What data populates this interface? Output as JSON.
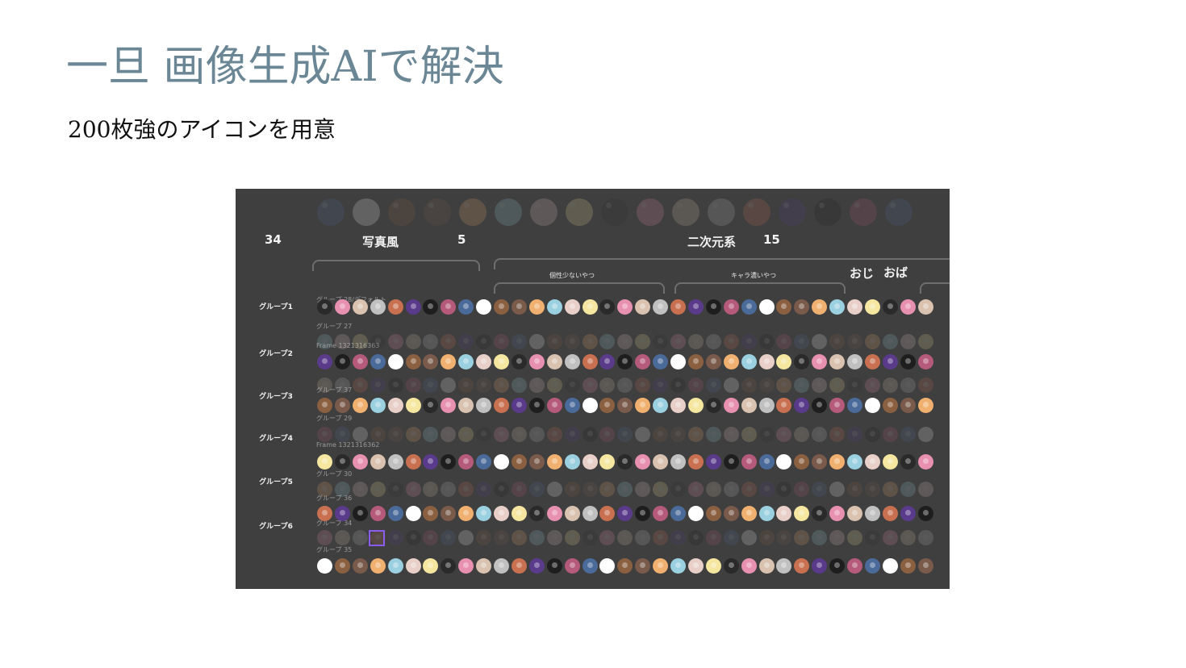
{
  "slide": {
    "title": "一旦 画像生成AIで解決",
    "subtitle": "200枚強のアイコンを用意"
  },
  "figma": {
    "counts": {
      "left": "34",
      "photo": "5",
      "anime": "15"
    },
    "headers": {
      "photo": "写真風",
      "anime": "二次元系",
      "oji": "おじ",
      "oba": "おば"
    },
    "sub_headers": {
      "first": "個性少ないやつ",
      "second": "キャラ濃いやつ"
    },
    "groups": [
      "グループ1",
      "グループ2",
      "グループ3",
      "グループ4",
      "グループ5",
      "グループ6"
    ],
    "frame_labels": [
      "グループ 28/デフォルト",
      "グループ 27",
      "Frame 1321316363",
      "グループ 37",
      "グループ 29",
      "Frame 1321316362",
      "グループ 30",
      "グループ 36",
      "グループ 34",
      "グループ 35"
    ],
    "palette": [
      "#7a5a4a",
      "#d9c2b0",
      "#ffffff",
      "#2a2a2a",
      "#b55a7a",
      "#e8d0c8",
      "#5a3a8a",
      "#f0b070",
      "#c0c0c0",
      "#8a6040",
      "#e890b0",
      "#4a6a9a",
      "#f5e6a0",
      "#1e1e1e",
      "#9ad0e0",
      "#c87050"
    ]
  }
}
